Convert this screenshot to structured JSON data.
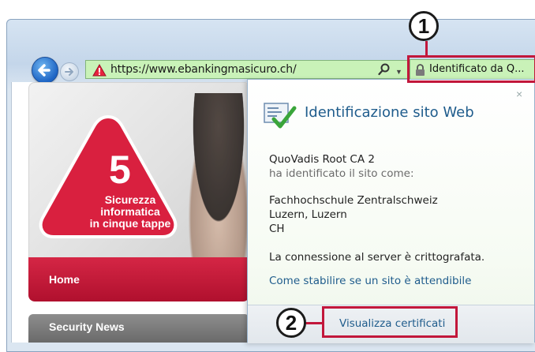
{
  "address_bar": {
    "url_scheme": "https://",
    "url_host": "www.ebankingmasicuro.ch/",
    "identity_label": "Identificato da Q..."
  },
  "page": {
    "badge_number": "5",
    "badge_text_line1": "Sicurezza",
    "badge_text_line2": "informatica",
    "badge_text_line3": "in cinque tappe",
    "home_label": "Home",
    "news_label": "Security News"
  },
  "popup": {
    "title": "Identificazione sito Web",
    "ca_name": "QuoVadis Root CA 2",
    "identified_as": "ha identificato il sito come:",
    "org_name": "Fachhochschule Zentralschweiz",
    "org_city": "Luzern, Luzern",
    "org_country": "CH",
    "encryption_text": "La connessione al server è crittografata.",
    "trust_link": "Come stabilire se un sito è attendibile",
    "view_cert_link": "Visualizza certificati",
    "close_glyph": "×"
  },
  "callouts": {
    "one": "1",
    "two": "2"
  },
  "colors": {
    "secure_green": "#c9f2b8",
    "brand_red": "#c2173b",
    "link_blue": "#1f5c8c"
  },
  "icons": [
    "back-arrow-icon",
    "forward-arrow-icon",
    "warning-triangle-icon",
    "search-icon",
    "dropdown-icon",
    "lock-icon",
    "certificate-icon",
    "close-icon"
  ]
}
